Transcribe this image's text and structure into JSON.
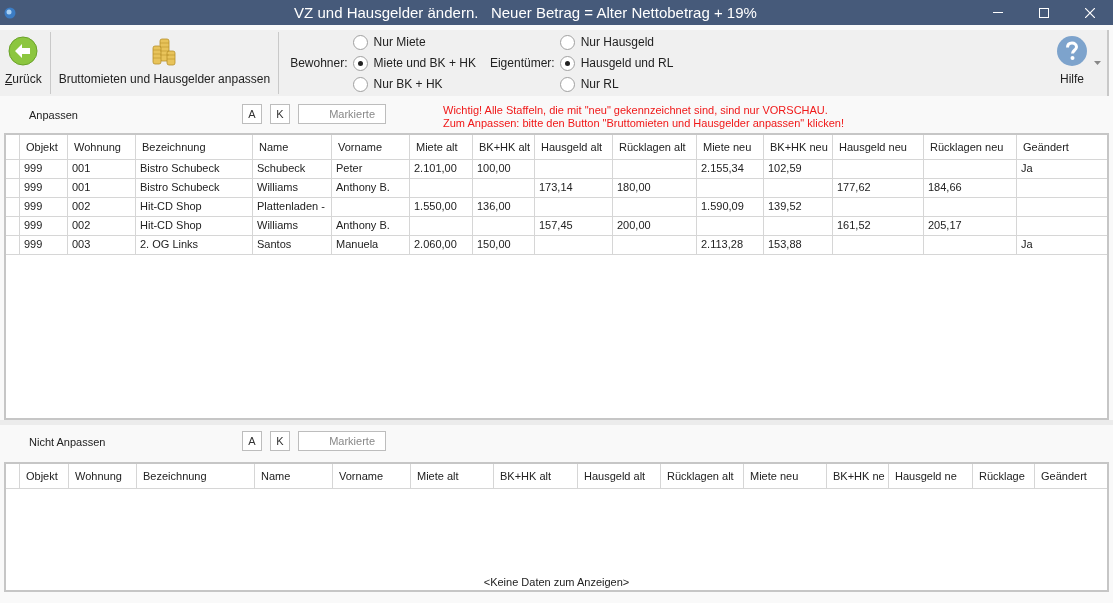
{
  "window": {
    "title": "VZ und Hausgelder ändern.   Neuer Betrag = Alter Nettobetrag + 19%"
  },
  "toolbar": {
    "back_button": "Zurück",
    "adjust_button": "Bruttomieten und Hausgelder anpassen",
    "groups": [
      {
        "label": "Bewohner:",
        "options": [
          {
            "label": "Nur Miete",
            "selected": false
          },
          {
            "label": "Miete und BK + HK",
            "selected": true
          },
          {
            "label": "Nur BK + HK",
            "selected": false
          }
        ]
      },
      {
        "label": "Eigentümer:",
        "options": [
          {
            "label": "Nur Hausgeld",
            "selected": false
          },
          {
            "label": "Hausgeld und RL",
            "selected": true
          },
          {
            "label": "Nur RL",
            "selected": false
          }
        ]
      }
    ],
    "help_button": "Hilfe"
  },
  "grids": [
    {
      "title": "Anpassen",
      "buttons": [
        "A",
        "K"
      ],
      "marked_button": "Markierte",
      "notice": [
        "Wichtig! Alle Staffeln, die mit \"neu\" gekennzeichnet sind, sind nur VORSCHAU.",
        "Zum Anpassen: bitte den Button \"Bruttomieten und Hausgelder anpassen\" klicken!"
      ],
      "columns": [
        "Objekt",
        "Wohnung",
        "Bezeichnung",
        "Name",
        "Vorname",
        "Miete alt",
        "BK+HK alt",
        "Hausgeld alt",
        "Rücklagen alt",
        "Miete neu",
        "BK+HK neu",
        "Hausgeld neu",
        "Rücklagen neu",
        "Geändert"
      ],
      "rows": [
        [
          "999",
          "001",
          "Bistro Schubeck",
          "Schubeck",
          "Peter",
          "2.101,00",
          "100,00",
          null,
          null,
          "2.155,34",
          "102,59",
          null,
          null,
          "Ja"
        ],
        [
          "999",
          "001",
          "Bistro Schubeck",
          "Williams",
          "Anthony B.",
          null,
          null,
          "173,14",
          "180,00",
          null,
          null,
          "177,62",
          "184,66",
          null
        ],
        [
          "999",
          "002",
          "Hit-CD Shop",
          "Plattenladen -",
          null,
          "1.550,00",
          "136,00",
          null,
          null,
          "1.590,09",
          "139,52",
          null,
          null,
          null
        ],
        [
          "999",
          "002",
          "Hit-CD Shop",
          "Williams",
          "Anthony B.",
          null,
          null,
          "157,45",
          "200,00",
          null,
          null,
          "161,52",
          "205,17",
          null
        ],
        [
          "999",
          "003",
          "2. OG Links",
          "Santos",
          "Manuela",
          "2.060,00",
          "150,00",
          null,
          null,
          "2.113,28",
          "153,88",
          null,
          null,
          "Ja"
        ]
      ]
    },
    {
      "title": "Nicht Anpassen",
      "buttons": [
        "A",
        "K"
      ],
      "marked_button": "Markierte",
      "columns": [
        "Objekt",
        "Wohnung",
        "Bezeichnung",
        "Name",
        "Vorname",
        "Miete alt",
        "BK+HK alt",
        "Hausgeld alt",
        "Rücklagen alt",
        "Miete neu",
        "BK+HK ne",
        "Hausgeld ne",
        "Rücklage",
        "Geändert"
      ],
      "empty_text": "<Keine Daten zum Anzeigen>"
    }
  ]
}
